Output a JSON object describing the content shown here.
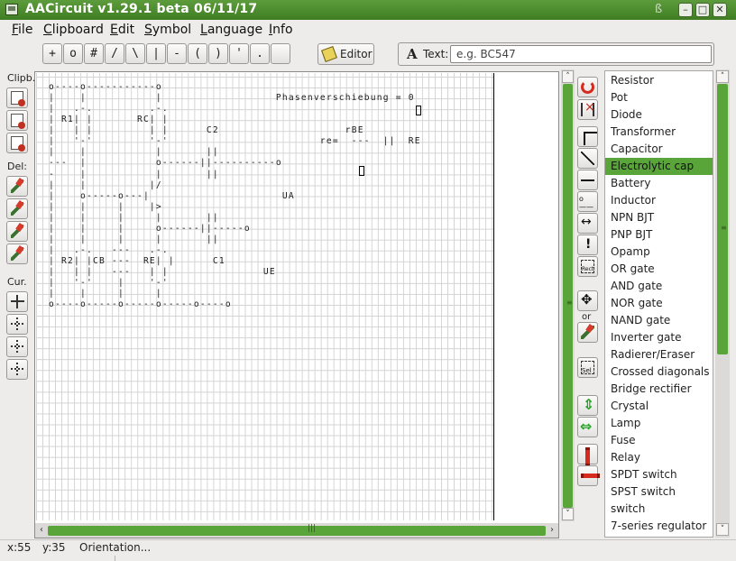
{
  "window": {
    "title": "AACircuit v1.29.1 beta 06/11/17"
  },
  "menu": [
    "File",
    "Clipboard",
    "Edit",
    "Symbol",
    "Language",
    "Info"
  ],
  "toolbar": {
    "chars": [
      "+",
      "o",
      "#",
      "/",
      "\\",
      "|",
      "-",
      "(",
      ")",
      "'",
      "."
    ],
    "editor_label": "Editor",
    "text_label": "Text:",
    "text_placeholder": "e.g. BC547",
    "text_value": ""
  },
  "left_tools": {
    "clipboard_label": "Clipb.",
    "delete_label": "Del:",
    "cursor_label": "Cur."
  },
  "diagram_text": "o----o-----------o\n|    |           |                  Phasenverschiebung = 0\n|   .-.         .-.\n| R1| |       RC| |\n|   | |         | |      C2                    rBE\n|   '-'         '-'                        re=  ---  ||  RE\n|    |           |       ||                     \n---  |           o------||----------o\n-    |           |       ||\n|    |          |/\n|    o-----o---|                     UA\n|    |     |    |>\n|    |     |     |       ||\n|    |     |     o------||-----o\n|    |     |     |       ||\n|   .-.   ---   .-.\n| R2| |CB ---  RE| |      C1\n|   | |   ---   | |               UE\n|   '-'    |    '-'\n|    |     |     |\no----o-----o-----o-----o----o",
  "symbol_tools": {
    "or_label": "or"
  },
  "symbols": [
    "Resistor",
    "Pot",
    "Diode",
    "Transformer",
    "Capacitor",
    "Electrolytic cap",
    "Battery",
    "Inductor",
    "NPN BJT",
    "PNP BJT",
    "Opamp",
    "OR gate",
    "AND gate",
    "NOR gate",
    "NAND gate",
    "Inverter gate",
    "Radierer/Eraser",
    "Crossed diagonals",
    "Bridge rectifier",
    "Crystal",
    "Lamp",
    "Fuse",
    "Relay",
    "SPDT switch",
    "SPST switch",
    "switch",
    "7-series regulator"
  ],
  "selected_symbol": "Electrolytic cap",
  "status": {
    "x": "x:55",
    "y": "y:35",
    "message": "Orientation..."
  },
  "colors": {
    "accent": "#5aa53a",
    "titlebar": "#4a8a2c",
    "delete": "#d62a1c"
  }
}
